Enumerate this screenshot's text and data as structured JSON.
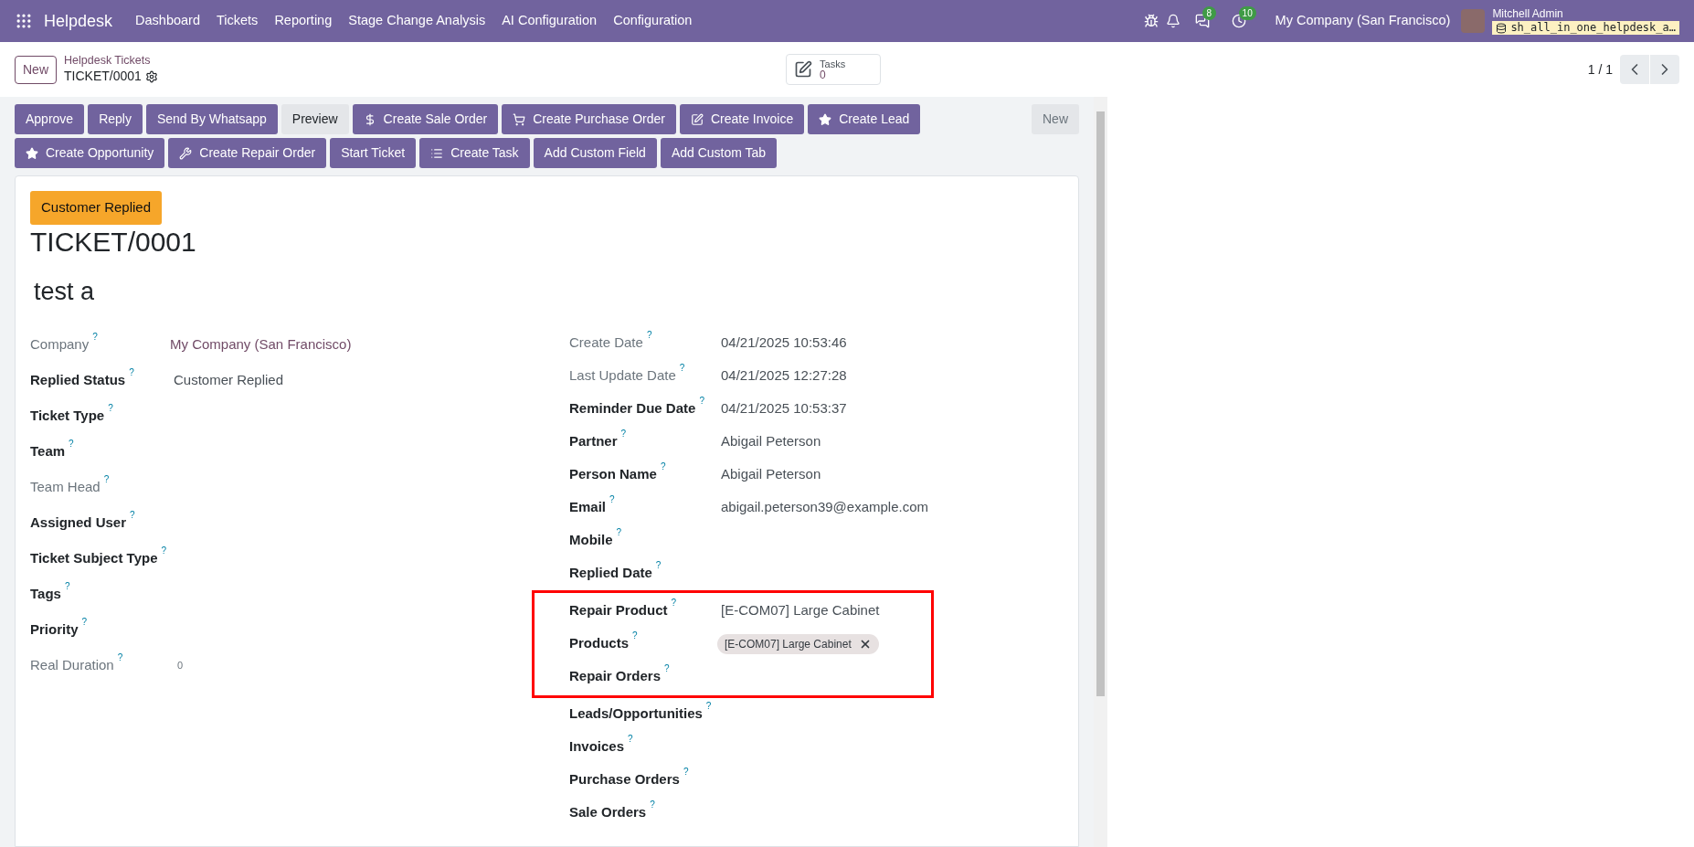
{
  "navbar": {
    "app": "Helpdesk",
    "menu": [
      "Dashboard",
      "Tickets",
      "Reporting",
      "Stage Change Analysis",
      "AI Configuration",
      "Configuration"
    ],
    "chat_count": "8",
    "activity_count": "10",
    "company": "My Company (San Francisco)",
    "user": "Mitchell Admin",
    "database": "sh_all_in_one_helpdesk_a…"
  },
  "control_panel": {
    "new_button": "New",
    "breadcrumb": "Helpdesk Tickets",
    "record": "TICKET/0001",
    "smart_button": {
      "label": "Tasks",
      "value": "0"
    },
    "pager": "1 / 1"
  },
  "actions": [
    {
      "label": "Approve",
      "kind": "primary"
    },
    {
      "label": "Reply",
      "kind": "primary"
    },
    {
      "label": "Send By Whatsapp",
      "kind": "primary"
    },
    {
      "label": "Preview",
      "kind": "secondary"
    },
    {
      "label": "Create Sale Order",
      "kind": "primary"
    },
    {
      "label": "Create Purchase Order",
      "kind": "primary"
    },
    {
      "label": "Create Invoice",
      "kind": "primary"
    },
    {
      "label": "Create Lead",
      "kind": "primary"
    },
    {
      "label": "Create Opportunity",
      "kind": "primary"
    },
    {
      "label": "Create Repair Order",
      "kind": "primary"
    },
    {
      "label": "Start Ticket",
      "kind": "primary"
    },
    {
      "label": "Create Task",
      "kind": "primary"
    },
    {
      "label": "Add Custom Field",
      "kind": "primary"
    },
    {
      "label": "Add Custom Tab",
      "kind": "primary"
    }
  ],
  "side_new_button": "New",
  "form": {
    "status": "Customer Replied",
    "name": "TICKET/0001",
    "subject": "test a",
    "left_fields": [
      {
        "label": "Company",
        "help": "?",
        "muted": true,
        "kind": "link",
        "value": "My Company (San Francisco)"
      },
      {
        "label": "Replied Status",
        "help": "?",
        "muted": false,
        "kind": "text",
        "value": "Customer Replied"
      },
      {
        "label": "Ticket Type",
        "help": "?",
        "muted": false
      },
      {
        "label": "Team",
        "help": "?",
        "muted": false
      },
      {
        "label": "Team Head",
        "help": "?",
        "muted": true
      },
      {
        "label": "Assigned User",
        "help": "?",
        "muted": false
      },
      {
        "label": "Ticket Subject Type",
        "help": "?",
        "muted": false
      },
      {
        "label": "Tags",
        "help": "?",
        "muted": false
      },
      {
        "label": "Priority",
        "help": "?",
        "muted": false
      },
      {
        "label": "Real Duration",
        "help": "?",
        "muted": true,
        "kind": "small",
        "value": "0"
      }
    ],
    "right_fields": [
      {
        "label": "Create Date",
        "help": "?",
        "muted": true,
        "kind": "text",
        "value": "04/21/2025 10:53:46"
      },
      {
        "label": "Last Update Date",
        "help": "?",
        "muted": true,
        "kind": "text",
        "value": "04/21/2025 12:27:28"
      },
      {
        "label": "Reminder Due Date",
        "help": "?",
        "muted": false,
        "kind": "text",
        "value": "04/21/2025 10:53:37"
      },
      {
        "label": "Partner",
        "help": "?",
        "muted": false,
        "kind": "text",
        "value": "Abigail Peterson"
      },
      {
        "label": "Person Name",
        "help": "?",
        "muted": false,
        "kind": "text",
        "value": "Abigail Peterson"
      },
      {
        "label": "Email",
        "help": "?",
        "muted": false,
        "kind": "text",
        "value": "abigail.peterson39@example.com"
      },
      {
        "label": "Mobile",
        "help": "?",
        "muted": false
      },
      {
        "label": "Replied Date",
        "help": "?",
        "muted": false
      }
    ],
    "highlighted_fields": [
      {
        "label": "Repair Product",
        "help": "?",
        "muted": false,
        "kind": "text",
        "value": "[E-COM07] Large Cabinet"
      },
      {
        "label": "Products",
        "help": "?",
        "muted": false,
        "kind": "tag",
        "value": "[E-COM07] Large Cabinet"
      },
      {
        "label": "Repair Orders",
        "help": "?",
        "muted": false
      }
    ],
    "more_fields": [
      {
        "label": "Leads/Opportunities",
        "help": "?",
        "muted": false
      },
      {
        "label": "Invoices",
        "help": "?",
        "muted": false
      },
      {
        "label": "Purchase Orders",
        "help": "?",
        "muted": false
      },
      {
        "label": "Sale Orders",
        "help": "?",
        "muted": false
      }
    ]
  }
}
